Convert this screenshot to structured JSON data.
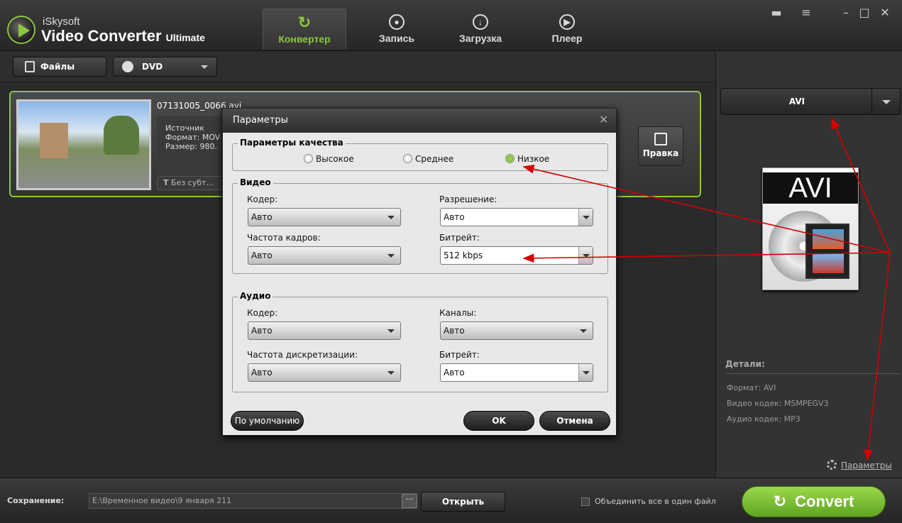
{
  "app": {
    "brand_top": "iSkysoft",
    "brand_main": "Video Converter",
    "brand_edition": "Ultimate",
    "tabs": [
      {
        "label": "Конвертер",
        "icon": "convert-icon",
        "active": true
      },
      {
        "label": "Запись",
        "icon": "record-icon",
        "active": false
      },
      {
        "label": "Загрузка",
        "icon": "download-icon",
        "active": false
      },
      {
        "label": "Плеер",
        "icon": "play-icon",
        "active": false
      }
    ],
    "accent_color": "#8cc63f"
  },
  "toolbar": {
    "files_label": "Файлы",
    "dvd_label": "DVD"
  },
  "file_item": {
    "name": "07131005_0066.avi",
    "source_label": "Источник",
    "format_label": "Формат: MOV",
    "size_label": "Размер: 980.",
    "subtitle_value": "Без субт...",
    "edit_label": "Правка"
  },
  "dialog": {
    "title": "Параметры",
    "quality": {
      "title": "Параметры качества",
      "options": [
        {
          "label": "Высокое",
          "selected": false
        },
        {
          "label": "Среднее",
          "selected": false
        },
        {
          "label": "Низкое",
          "selected": true
        }
      ]
    },
    "video": {
      "title": "Видео",
      "encoder_label": "Кодер:",
      "encoder_value": "Авто",
      "resolution_label": "Разрешение:",
      "resolution_value": "Авто",
      "framerate_label": "Частота кадров:",
      "framerate_value": "Авто",
      "bitrate_label": "Битрейт:",
      "bitrate_value": "512 kbps"
    },
    "audio": {
      "title": "Аудио",
      "encoder_label": "Кодер:",
      "encoder_value": "Авто",
      "channels_label": "Каналы:",
      "channels_value": "Авто",
      "samplerate_label": "Частота дискретизации:",
      "samplerate_value": "Авто",
      "bitrate_label": "Битрейт:",
      "bitrate_value": "Авто"
    },
    "default_label": "По умолчанию",
    "ok_label": "OK",
    "cancel_label": "Отмена"
  },
  "right_panel": {
    "format_value": "AVI",
    "format_icon_text": "AVI",
    "details_title": "Детали:",
    "detail_format": "Формат: AVI",
    "detail_video": "Видео кодек: MSMPEGV3",
    "detail_audio": "Аудио кодек: MP3",
    "params_link": "Параметры"
  },
  "bottom": {
    "save_label": "Сохранение:",
    "save_path": "E:\\Временное видео\\9 января 211",
    "browse_label": "···",
    "open_label": "Открыть",
    "merge_label": "Объединить все в один файл",
    "convert_label": "Convert"
  },
  "annotation_color": "#d40000"
}
